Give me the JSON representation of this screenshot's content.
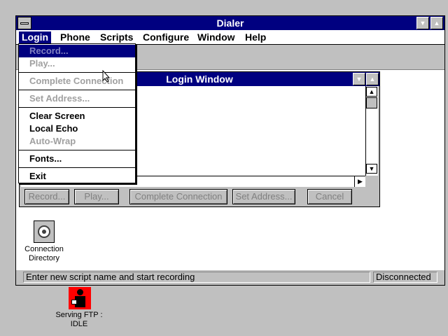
{
  "app": {
    "title": "Dialer"
  },
  "menubar": [
    {
      "label": "Login"
    },
    {
      "label": "Phone"
    },
    {
      "label": "Scripts"
    },
    {
      "label": "Configure"
    },
    {
      "label": "Window"
    },
    {
      "label": "Help"
    }
  ],
  "dropdown": {
    "items": [
      {
        "label": "Record...",
        "state": "selected"
      },
      {
        "label": "Play...",
        "state": "disabled"
      },
      {
        "label": "Complete Connection",
        "state": "disabled"
      },
      {
        "label": "Set Address...",
        "state": "disabled"
      },
      {
        "label": "Clear Screen",
        "state": "enabled"
      },
      {
        "label": "Local Echo",
        "state": "enabled"
      },
      {
        "label": "Auto-Wrap",
        "state": "disabled"
      },
      {
        "label": "Fonts...",
        "state": "enabled"
      },
      {
        "label": "Exit",
        "state": "enabled"
      }
    ]
  },
  "login_window": {
    "title": "Login Window",
    "buttons": {
      "record": "Record...",
      "play": "Play...",
      "complete": "Complete Connection",
      "set_address": "Set Address...",
      "cancel": "Cancel"
    }
  },
  "desktop_icon": {
    "label_line1": "Connection",
    "label_line2": "Directory"
  },
  "statusbar": {
    "message": "Enter new script name and start recording",
    "state": "Disconnected"
  },
  "taskbar_icon": {
    "label_line1": "Serving FTP :",
    "label_line2": "IDLE"
  },
  "colors": {
    "titlebar": "#000080",
    "face": "#c0c0c0",
    "ftp_icon_bg": "#ff0000"
  },
  "icons": [
    "system-menu-icon",
    "minimize-arrow-icon",
    "maximize-arrow-icon",
    "telephone-icon",
    "person-icon",
    "mouse-cursor-icon"
  ]
}
